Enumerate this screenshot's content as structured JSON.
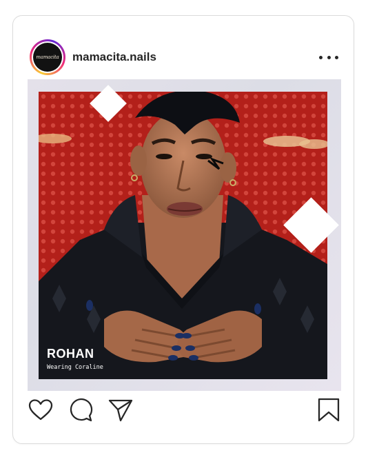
{
  "post": {
    "username": "mamacita.nails",
    "avatar_text": "mamacita",
    "media": {
      "overlay_name": "ROHAN",
      "overlay_sub": "Wearing Coraline"
    }
  },
  "icons": {
    "like": "heart-icon",
    "comment": "comment-icon",
    "share": "paper-plane-icon",
    "save": "bookmark-icon",
    "more": "more-horizontal-icon"
  },
  "colors": {
    "text": "#262626",
    "border": "#dbdbdb",
    "photo_bg": "#b01c18",
    "sweater": "#14161c"
  }
}
